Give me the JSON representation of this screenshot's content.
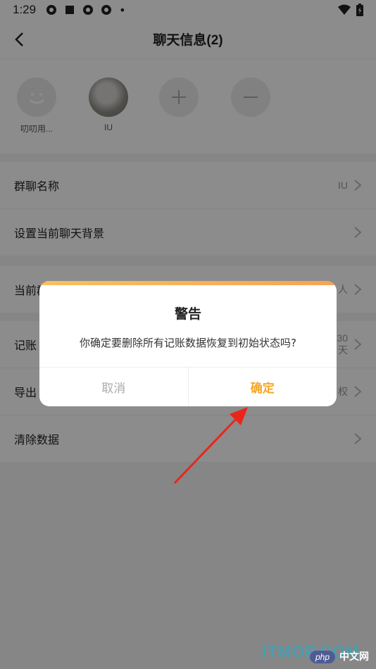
{
  "status_bar": {
    "time": "1:29",
    "dot": "•"
  },
  "nav": {
    "title": "聊天信息(2)"
  },
  "members": [
    {
      "name": "叨叨用...",
      "avatar": "smiley-avatar"
    },
    {
      "name": "IU",
      "avatar": "photo-avatar"
    }
  ],
  "settings": {
    "group_name_label": "群聊名称",
    "group_name_value": "IU",
    "background_label": "设置当前聊天背景",
    "current_label": "当前群",
    "current_value": "人",
    "record_label": "记账",
    "record_value_line1": "30",
    "record_value_line2": "天",
    "export_label": "导出",
    "export_value": "权",
    "clear_label": "清除数据"
  },
  "dialog": {
    "title": "警告",
    "message": "你确定要删除所有记账数据恢复到初始状态吗?",
    "cancel_label": "取消",
    "confirm_label": "确定"
  },
  "watermark": {
    "site": "ITMOP.COM",
    "php": "php",
    "cn": "中文网"
  },
  "colors": {
    "accent": "#f5a623",
    "overlay": "rgba(0,0,0,0.45)",
    "annotation_arrow": "#e8261c"
  }
}
